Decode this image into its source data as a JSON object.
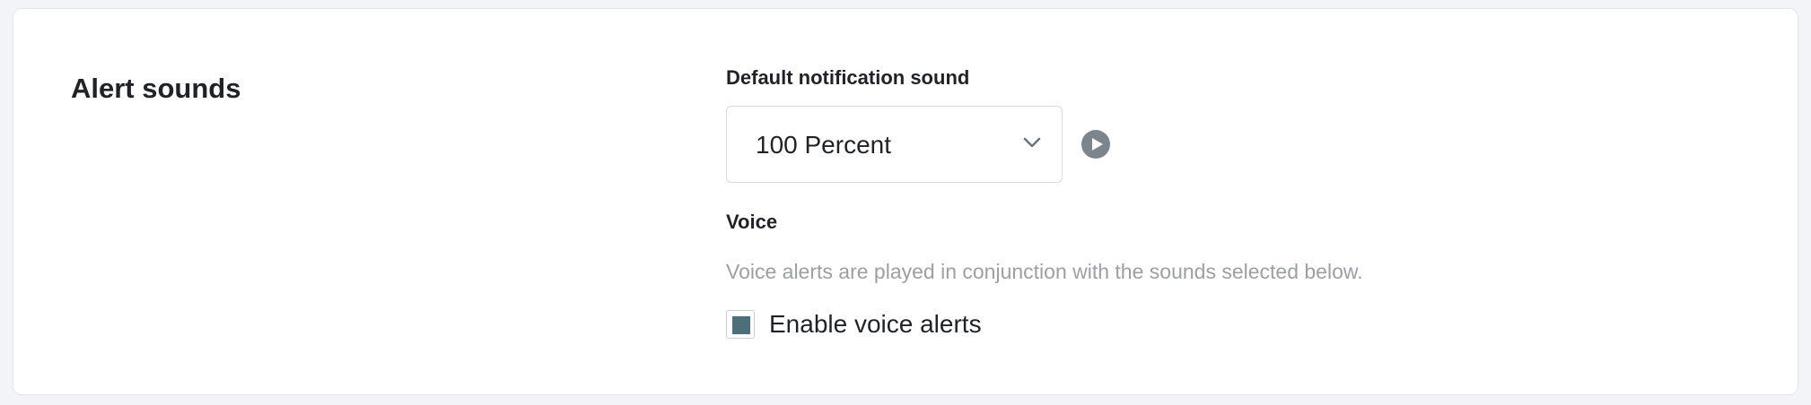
{
  "section": {
    "title": "Alert sounds"
  },
  "notification_sound": {
    "label": "Default notification sound",
    "selected": "100 Percent"
  },
  "voice": {
    "label": "Voice",
    "help_text": "Voice alerts are played in conjunction with the sounds selected below.",
    "checkbox_label": "Enable voice alerts",
    "checked": true
  },
  "colors": {
    "accent": "#4d6f7c",
    "play_icon": "#7d858c",
    "help_text": "#9aa0a6"
  },
  "icons": {
    "dropdown": "chevron-down-icon",
    "play": "play-circle-icon"
  }
}
